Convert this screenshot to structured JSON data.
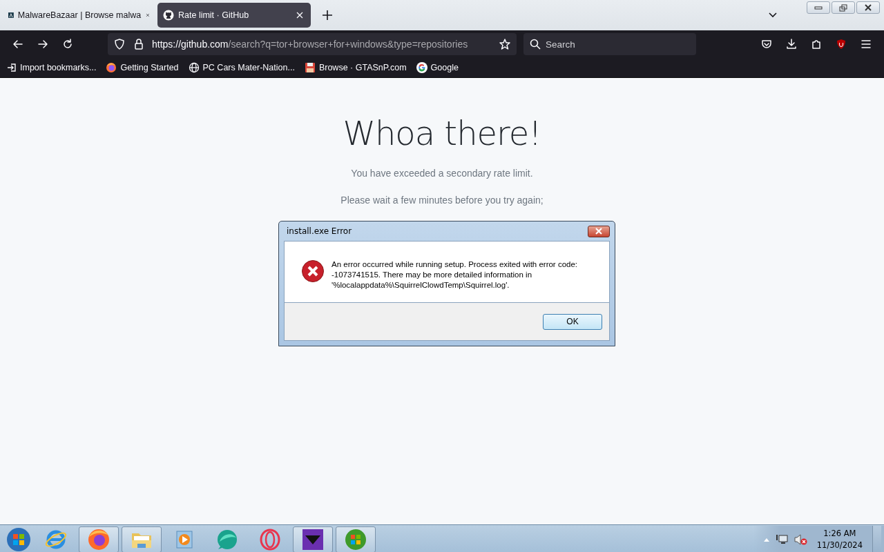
{
  "tabs": [
    {
      "title": "MalwareBazaar | Browse malwa",
      "kind": "bazaar",
      "selected": false
    },
    {
      "title": "Rate limit · GitHub",
      "kind": "github",
      "selected": true
    }
  ],
  "url": {
    "host": "https://github.com",
    "path": "/search?q=tor+browser+for+windows&type=repositories"
  },
  "search": {
    "placeholder": "Search"
  },
  "bookmarks": [
    {
      "label": "Import bookmarks...",
      "kind": "import"
    },
    {
      "label": "Getting Started",
      "kind": "firefox"
    },
    {
      "label": "PC Cars Mater-Nation...",
      "kind": "globe"
    },
    {
      "label": "Browse · GTASnP.com",
      "kind": "floppy"
    },
    {
      "label": "Google",
      "kind": "google"
    }
  ],
  "page": {
    "heading": "Whoa there!",
    "lines": [
      "You have exceeded a secondary rate limit.",
      "Please wait a few minutes before you try again;"
    ]
  },
  "dialog": {
    "title": "install.exe Error",
    "message": "An error occurred while running setup. Process exited with error code: -1073741515. There may be more detailed information in '%localappdata%\\SquirrelClowdTemp\\Squirrel.log'.",
    "button": "OK"
  },
  "taskbar": {
    "items": [
      {
        "kind": "ie",
        "running": false
      },
      {
        "kind": "firefox",
        "running": true
      },
      {
        "kind": "folder",
        "running": true
      },
      {
        "kind": "media",
        "running": false
      },
      {
        "kind": "teal",
        "running": false
      },
      {
        "kind": "ring",
        "running": false
      },
      {
        "kind": "purple",
        "running": true
      },
      {
        "kind": "orb",
        "running": true
      }
    ],
    "time": "1:26 AM",
    "date": "11/30/2024"
  }
}
